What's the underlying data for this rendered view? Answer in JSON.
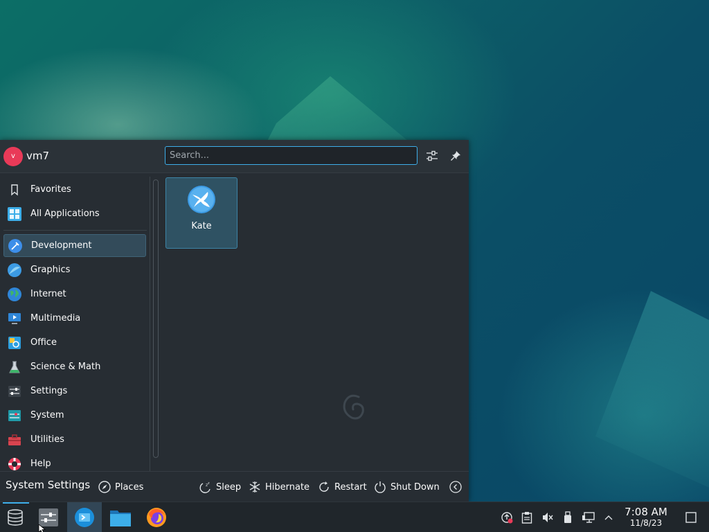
{
  "launcher": {
    "user": {
      "initial": "v",
      "name": "vm7"
    },
    "search": {
      "placeholder": "Search..."
    },
    "header_buttons": [
      {
        "name": "configure-icon"
      },
      {
        "name": "pin-icon"
      }
    ],
    "sidebar": {
      "items": [
        {
          "label": "Favorites",
          "icon": "bookmark-icon"
        },
        {
          "label": "All Applications",
          "icon": "grid-icon"
        },
        {
          "label": "Development",
          "icon": "development-icon",
          "active": true
        },
        {
          "label": "Graphics",
          "icon": "graphics-icon"
        },
        {
          "label": "Internet",
          "icon": "globe-icon"
        },
        {
          "label": "Multimedia",
          "icon": "multimedia-icon"
        },
        {
          "label": "Office",
          "icon": "office-icon"
        },
        {
          "label": "Science & Math",
          "icon": "flask-icon"
        },
        {
          "label": "Settings",
          "icon": "settings-icon"
        },
        {
          "label": "System",
          "icon": "system-icon"
        },
        {
          "label": "Utilities",
          "icon": "toolbox-icon"
        },
        {
          "label": "Help",
          "icon": "lifebuoy-icon"
        }
      ]
    },
    "apps": [
      {
        "label": "Kate",
        "icon": "kate-icon"
      }
    ],
    "footer": {
      "tooltip": "System Settings",
      "places": "Places",
      "sleep": "Sleep",
      "hibernate": "Hibernate",
      "restart": "Restart",
      "shutdown": "Shut Down"
    }
  },
  "taskbar": {
    "clock": {
      "time": "7:08 AM",
      "date": "11/8/23"
    },
    "launchers": [
      "application-launcher",
      "system-settings",
      "discover",
      "file-manager",
      "firefox"
    ]
  },
  "colors": {
    "accent": "#3daee9",
    "panel_bg": "#272d33",
    "avatar": "#e93a58"
  }
}
